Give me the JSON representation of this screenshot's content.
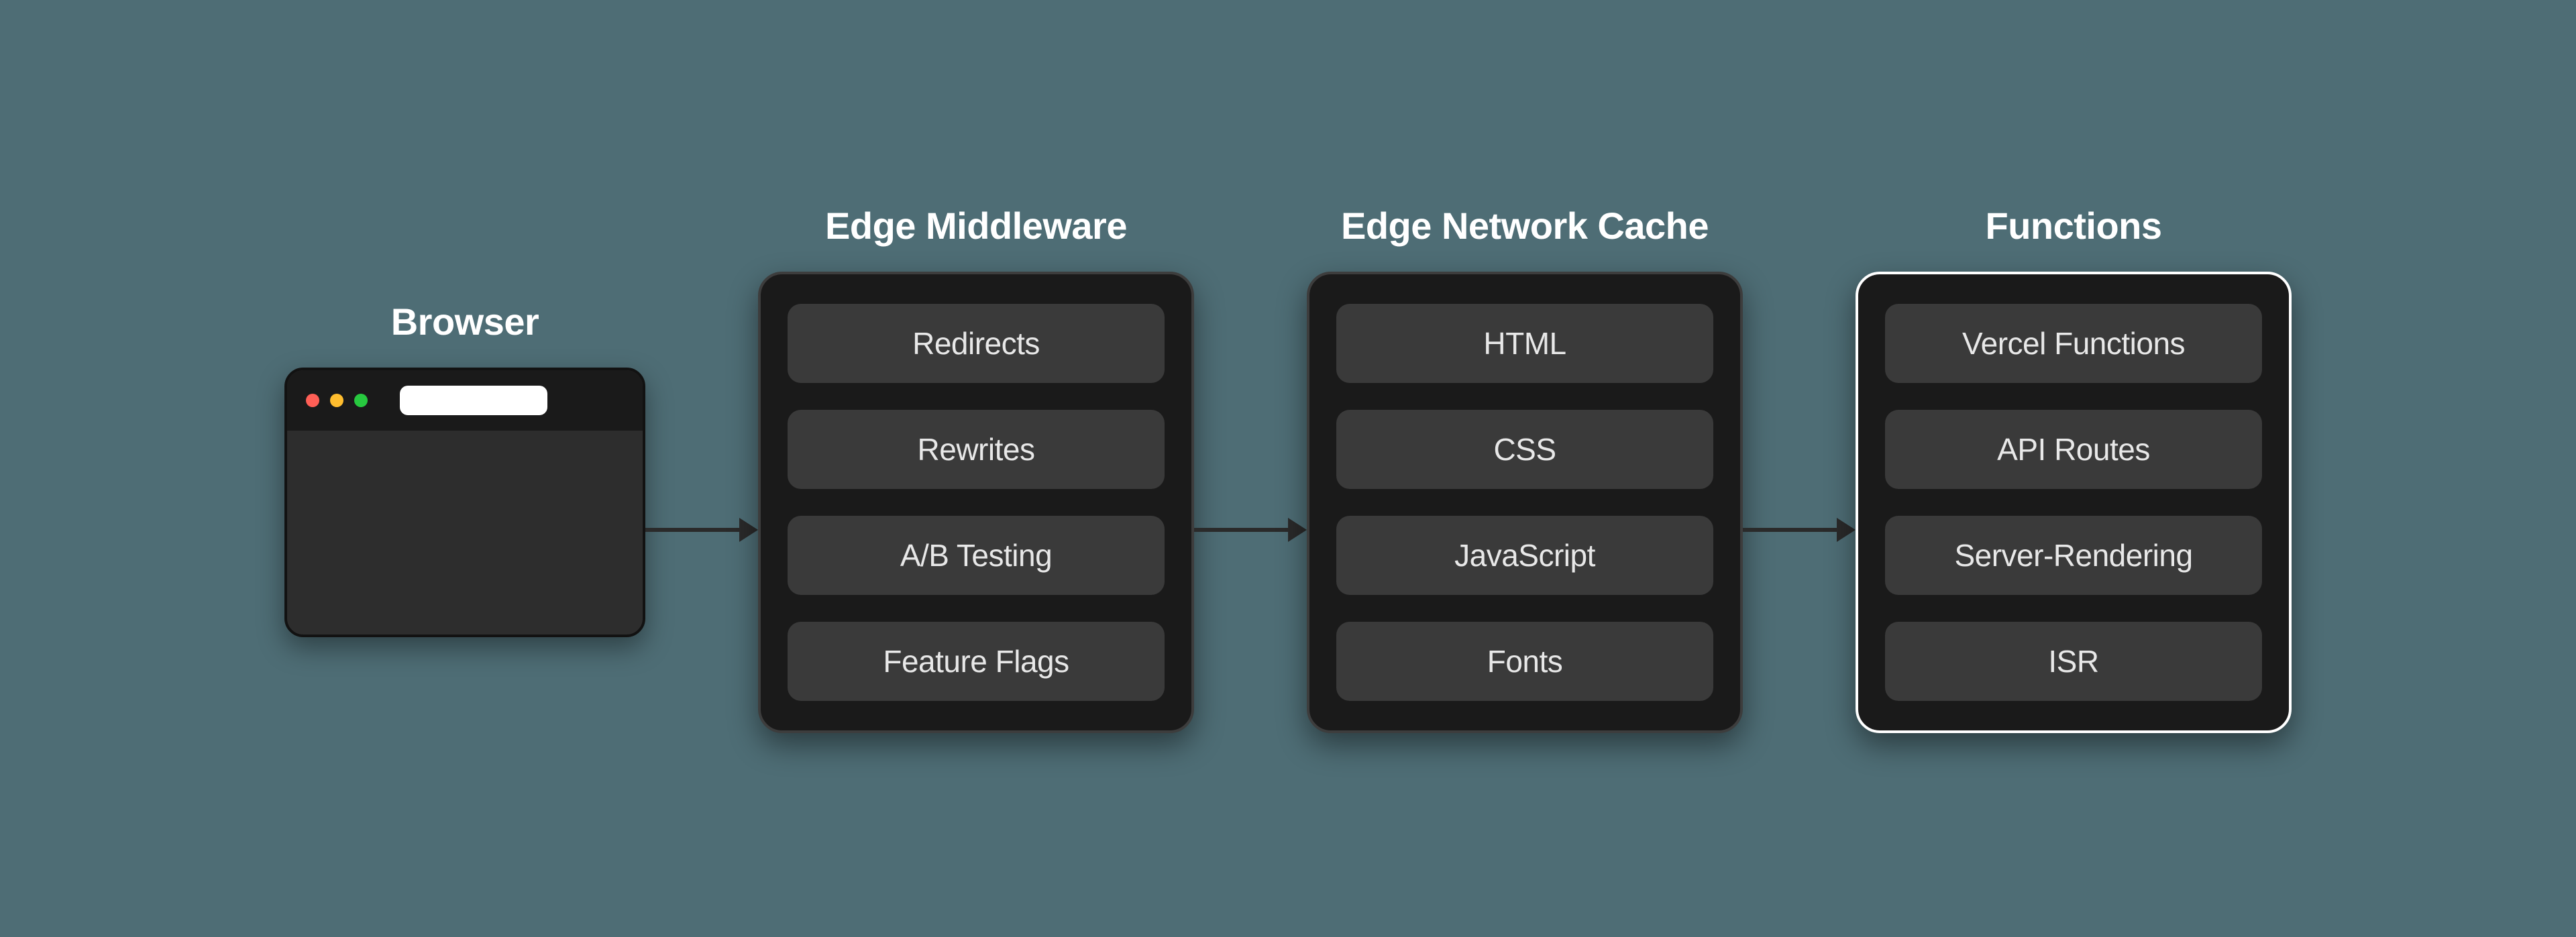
{
  "browser": {
    "heading": "Browser"
  },
  "stages": [
    {
      "heading": "Edge Middleware",
      "highlight": false,
      "items": [
        "Redirects",
        "Rewrites",
        "A/B Testing",
        "Feature Flags"
      ]
    },
    {
      "heading": "Edge Network Cache",
      "highlight": false,
      "items": [
        "HTML",
        "CSS",
        "JavaScript",
        "Fonts"
      ]
    },
    {
      "heading": "Functions",
      "highlight": true,
      "items": [
        "Vercel Functions",
        "API Routes",
        "Server-Rendering",
        "ISR"
      ]
    }
  ]
}
